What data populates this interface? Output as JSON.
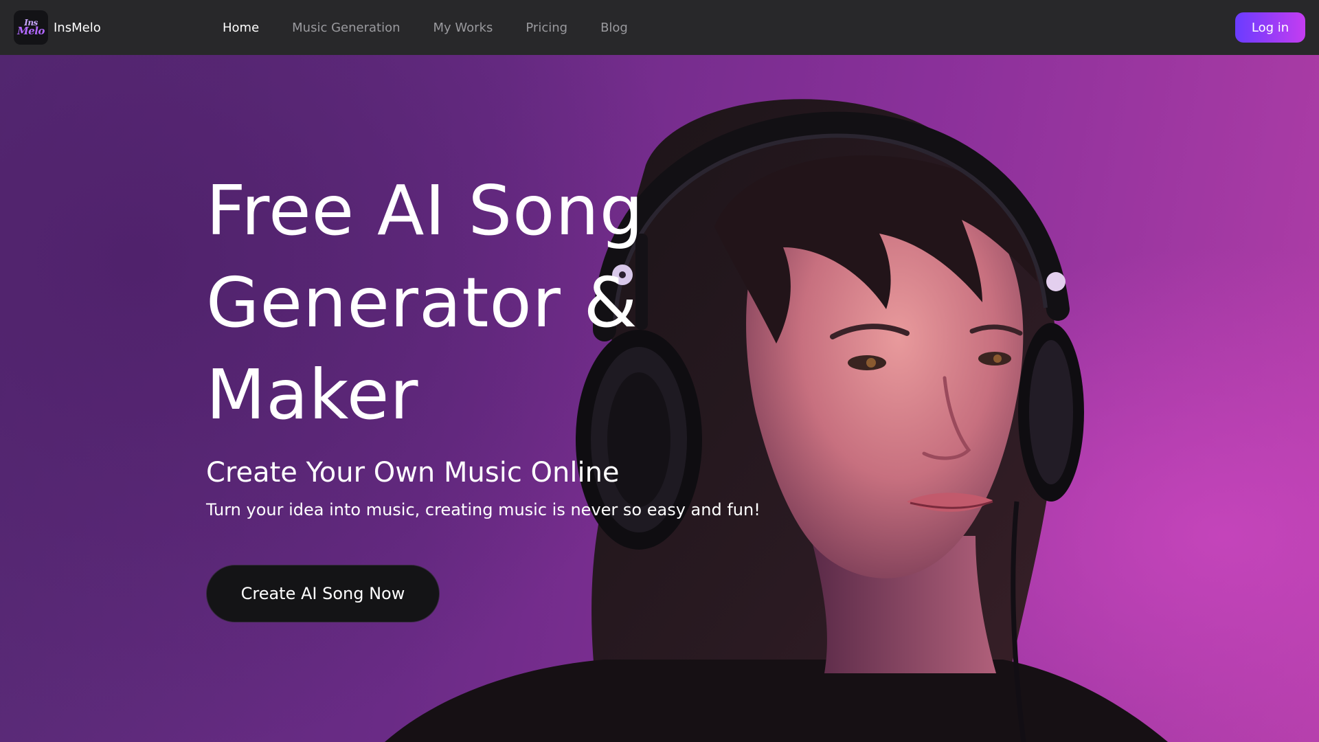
{
  "brand": {
    "logo_line1": "Ins",
    "logo_line2": "Melo",
    "name": "InsMelo"
  },
  "nav": {
    "items": [
      {
        "label": "Home",
        "active": true
      },
      {
        "label": "Music Generation",
        "active": false
      },
      {
        "label": "My Works",
        "active": false
      },
      {
        "label": "Pricing",
        "active": false
      },
      {
        "label": "Blog",
        "active": false
      }
    ],
    "login_label": "Log in"
  },
  "hero": {
    "title_line1": "Free AI Song",
    "title_line2": "Generator &",
    "title_line3": "Maker",
    "subtitle": "Create Your Own Music Online",
    "description": "Turn your idea into music, creating music is never so easy and fun!",
    "cta_label": "Create AI Song Now"
  },
  "colors": {
    "nav_bg": "#28282a",
    "accent_gradient_start": "#6a3cff",
    "accent_gradient_end": "#c43df0",
    "hero_purple": "#6a2b86",
    "hero_magenta": "#b13ea8",
    "cta_bg": "#141416"
  },
  "icons": {
    "logo": "insmelo-logo-icon",
    "hero_image": "woman-with-headphones-illustration"
  }
}
